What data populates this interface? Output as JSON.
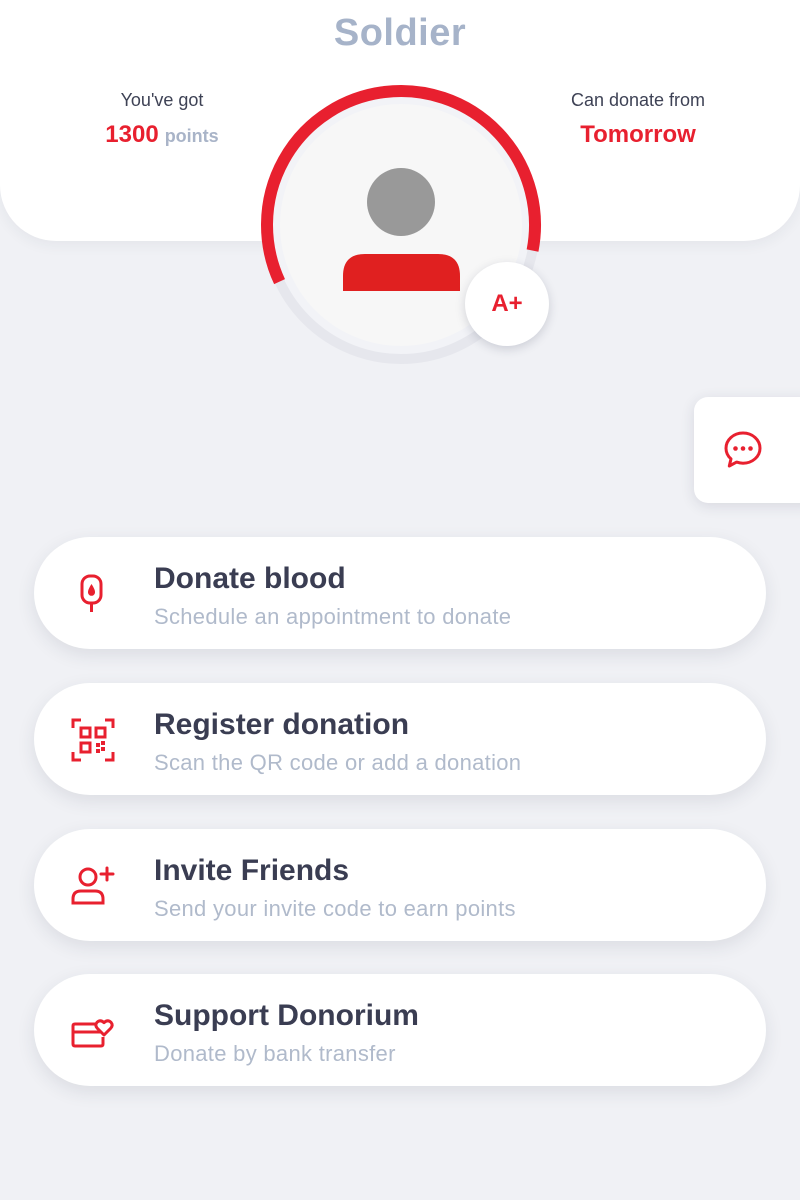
{
  "profile": {
    "rank": "Soldier",
    "points_label": "You've got",
    "points_value": "1300",
    "points_unit": "points",
    "next_donation_label": "Can donate from",
    "next_donation_value": "Tomorrow",
    "blood_type": "A+",
    "progress_fraction": 0.6
  },
  "colors": {
    "accent": "#e8202f",
    "muted_text": "#a6b3c9",
    "dark_text": "#3a3d52",
    "background": "#f0f1f5"
  },
  "menu": [
    {
      "icon": "blood-drip-icon",
      "title": "Donate blood",
      "subtitle": "Schedule an appointment to donate"
    },
    {
      "icon": "qr-code-icon",
      "title": "Register donation",
      "subtitle": "Scan the QR code or add a donation"
    },
    {
      "icon": "add-user-icon",
      "title": "Invite Friends",
      "subtitle": "Send your invite code to earn points"
    },
    {
      "icon": "card-heart-icon",
      "title": "Support Donorium",
      "subtitle": "Donate by bank transfer"
    }
  ],
  "chat_icon": "chat-bubble-icon"
}
